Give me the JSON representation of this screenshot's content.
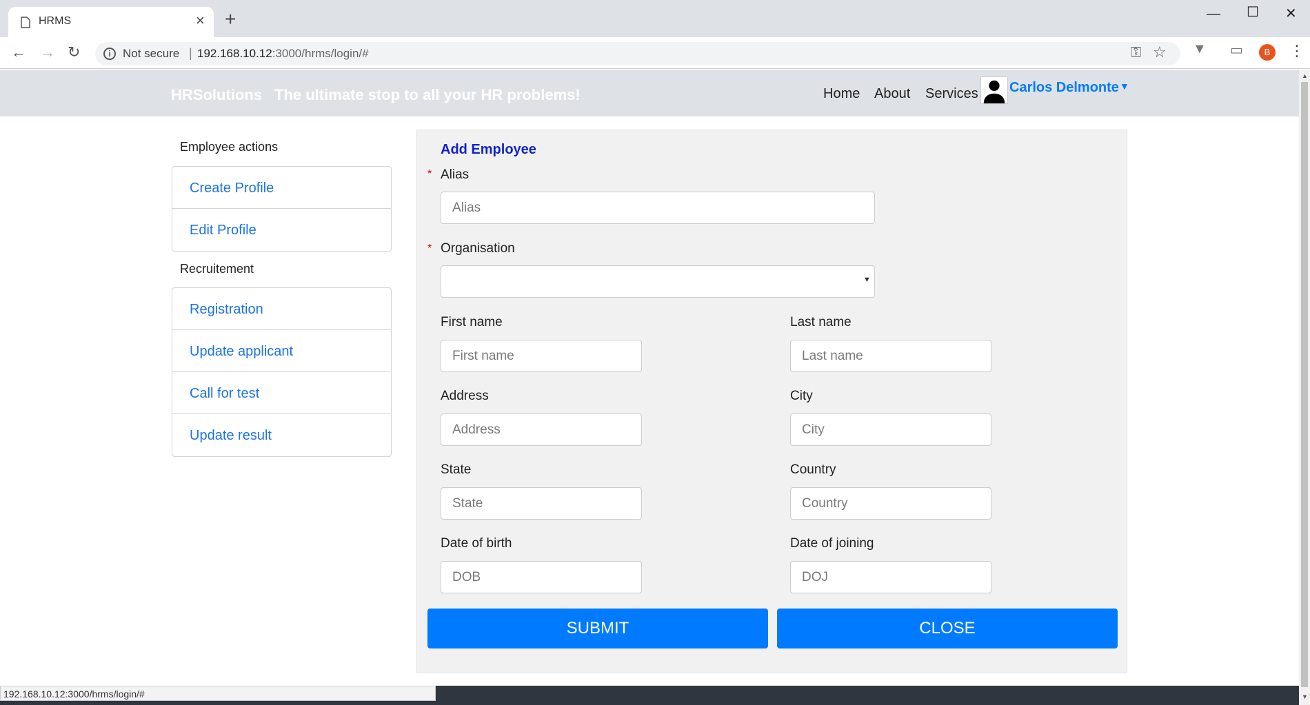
{
  "browser": {
    "tab_title": "HRMS",
    "security_label": "Not secure",
    "url_host": "192.168.10.12",
    "url_path": ":3000/hrms/login/#",
    "profile_initial": "B",
    "status_url": "192.168.10.12:3000/hrms/login/#"
  },
  "header": {
    "brand": "HRSolutions",
    "tagline": "The ultimate stop to all your HR problems!",
    "nav": [
      "Home",
      "About",
      "Services"
    ],
    "user_name": "Carlos Delmonte"
  },
  "sidebar": {
    "employee_heading": "Employee actions",
    "employee_items": [
      "Create Profile",
      "Edit Profile"
    ],
    "recruitment_heading": "Recruitement",
    "recruitment_items": [
      "Registration",
      "Update applicant",
      "Call for test",
      "Update result"
    ]
  },
  "form": {
    "title": "Add Employee",
    "required_mark": "*",
    "alias": {
      "label": "Alias",
      "placeholder": "Alias"
    },
    "organisation": {
      "label": "Organisation",
      "value": ""
    },
    "first_name": {
      "label": "First name",
      "placeholder": "First name"
    },
    "last_name": {
      "label": "Last name",
      "placeholder": "Last name"
    },
    "address": {
      "label": "Address",
      "placeholder": "Address"
    },
    "city": {
      "label": "City",
      "placeholder": "City"
    },
    "state": {
      "label": "State",
      "placeholder": "State"
    },
    "country": {
      "label": "Country",
      "placeholder": "Country"
    },
    "dob": {
      "label": "Date of birth",
      "placeholder": "DOB"
    },
    "doj": {
      "label": "Date of joining",
      "placeholder": "DOJ"
    },
    "submit_label": "SUBMIT",
    "close_label": "CLOSE"
  },
  "colors": {
    "primary": "#007bff",
    "header_bg": "#dee2e6",
    "panel_bg": "#f1f1f1",
    "title": "#1122cc",
    "required": "#cc0000"
  }
}
